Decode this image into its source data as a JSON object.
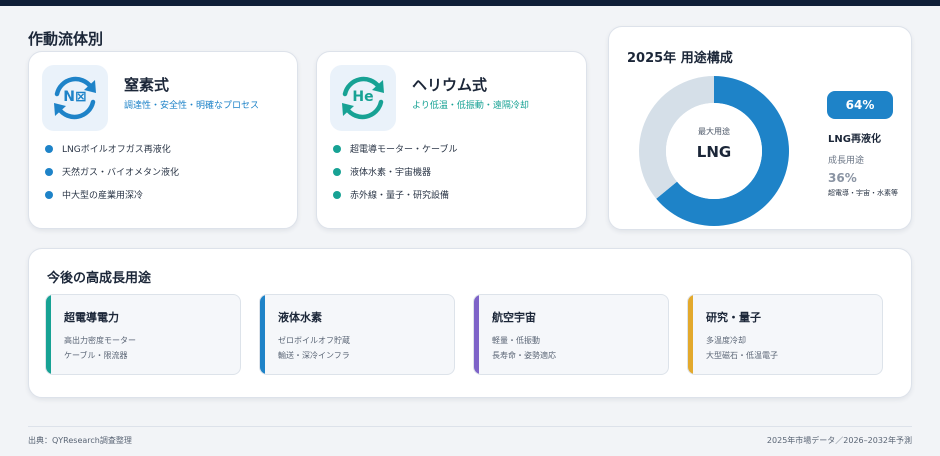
{
  "section_title": "作動流体別",
  "methods": [
    {
      "icon_letters": "N⊠",
      "title": "窒素式",
      "subtitle": "調達性・安全性・明確なプロセス",
      "color": "#1e83c8",
      "bullets": [
        "LNGボイルオフガス再液化",
        "天然ガス・バイオメタン液化",
        "中大型の産業用深冷"
      ]
    },
    {
      "icon_letters": "He",
      "title": "ヘリウム式",
      "subtitle": "より低温・低振動・遠隔冷却",
      "color": "#17a294",
      "bullets": [
        "超電導モーター・ケーブル",
        "液体水素・宇宙機器",
        "赤外線・量子・研究設備"
      ]
    }
  ],
  "pie": {
    "title": "2025年 用途構成",
    "center_small": "最大用途",
    "center_big": "LNG",
    "badge": "64%",
    "lng_label": "LNG再液化",
    "grow_label": "成長用途",
    "other_pct": "36%",
    "other_label": "超電導・宇宙・水素等"
  },
  "chart_data": {
    "type": "pie",
    "title": "2025年 用途構成",
    "categories": [
      "LNG再液化",
      "超電導・宇宙・水素等"
    ],
    "values": [
      64,
      36
    ],
    "colors": [
      "#1e83c8",
      "#d5dfe8"
    ]
  },
  "apps": {
    "title": "今後の高成長用途",
    "items": [
      {
        "name": "超電導電力",
        "line1": "高出力密度モーター",
        "line2": "ケーブル・限流器",
        "color": "#17a294"
      },
      {
        "name": "液体水素",
        "line1": "ゼロボイルオフ貯蔵",
        "line2": "輸送・深冷インフラ",
        "color": "#1e83c8"
      },
      {
        "name": "航空宇宙",
        "line1": "軽量・低振動",
        "line2": "長寿命・姿勢適応",
        "color": "#7e63c8"
      },
      {
        "name": "研究・量子",
        "line1": "多温度冷却",
        "line2": "大型磁石・低温電子",
        "color": "#e3a92c"
      }
    ]
  },
  "footer": {
    "source": "出典：QYResearch調査整理",
    "note": "2025年市場データ／2026–2032年予測"
  }
}
